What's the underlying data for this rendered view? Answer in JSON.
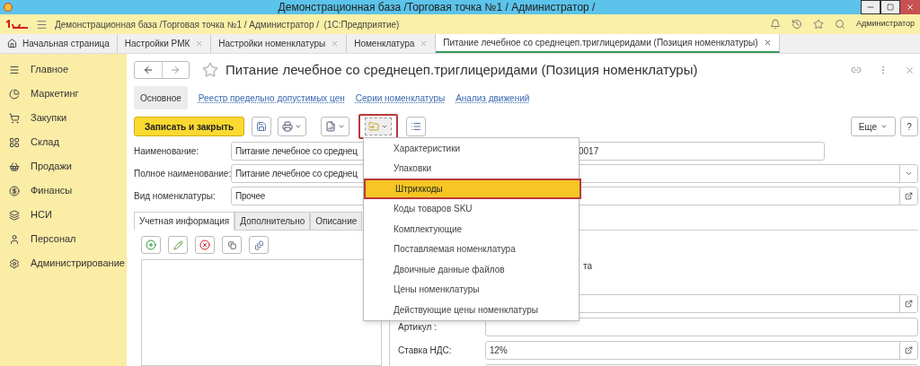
{
  "window": {
    "title": "Демонстрационная база /Торговая точка №1 / Администратор /"
  },
  "header": {
    "breadcrumb": "Демонстрационная база /Торговая точка №1 / Администратор /  (1С:Предприятие)",
    "user": "Администратор"
  },
  "open_tabs": [
    {
      "kind": "home",
      "label": "Начальная страница",
      "selected": false
    },
    {
      "kind": "page",
      "label": "Настройки РМК",
      "selected": false
    },
    {
      "kind": "page",
      "label": "Настройки номенклатуры",
      "selected": false
    },
    {
      "kind": "page",
      "label": "Номенклатура",
      "selected": false
    },
    {
      "kind": "page",
      "label": "Питание лечебное со среднецеп.триглицеридами (Позиция номенклатуры)",
      "selected": true
    }
  ],
  "sidebar": {
    "items": [
      {
        "label": "Главное"
      },
      {
        "label": "Маркетинг"
      },
      {
        "label": "Закупки"
      },
      {
        "label": "Склад"
      },
      {
        "label": "Продажи"
      },
      {
        "label": "Финансы"
      },
      {
        "label": "НСИ"
      },
      {
        "label": "Персонал"
      },
      {
        "label": "Администрирование"
      }
    ]
  },
  "form": {
    "title": "Питание лечебное со среднецеп.триглицеридами (Позиция номенклатуры)",
    "sections": [
      {
        "label": "Основное",
        "selected": true
      },
      {
        "label": "Реестр предельно допустимых цен",
        "selected": false
      },
      {
        "label": "Серии номенклатуры",
        "selected": false
      },
      {
        "label": "Анализ движений",
        "selected": false
      }
    ],
    "save_button": "Записать и закрыть",
    "create_menu": {
      "expanded": true
    },
    "more_button": "Еще",
    "help_button": "?",
    "fields": [
      {
        "kind": "text",
        "label": "Наименование:",
        "value": "Питание лечебное со среднец",
        "tail": "0017"
      },
      {
        "kind": "select",
        "label": "Полное наименование:",
        "value": "Питание лечебное со среднец"
      },
      {
        "kind": "open",
        "label": "Вид номенклатуры:",
        "value": "Прочее"
      }
    ],
    "tabs": [
      {
        "label": "Учетная информация",
        "selected": true
      },
      {
        "label": "Дополнительно",
        "selected": false
      },
      {
        "label": "Описание",
        "selected": false
      }
    ],
    "right_panel": {
      "fragment": "та",
      "fields": [
        {
          "kind": "open"
        },
        {
          "kind": "text",
          "label": "Артикул :"
        },
        {
          "kind": "open",
          "label": "Ставка НДС:",
          "value": "12%"
        },
        {
          "kind": "text"
        }
      ]
    }
  },
  "menu": {
    "items": [
      {
        "label": "Характеристики",
        "selected": false
      },
      {
        "label": "Упаковки",
        "selected": false
      },
      {
        "label": "Штрихкоды",
        "selected": true
      },
      {
        "label": "Коды товаров SKU",
        "selected": false
      },
      {
        "label": "Комплектующие",
        "selected": false
      },
      {
        "label": "Поставляемая номенклатура",
        "selected": false
      },
      {
        "label": "Двоичные данные файлов",
        "selected": false
      },
      {
        "label": "Цены номенклатуры",
        "selected": false
      },
      {
        "label": "Действующие цены номенклатуры",
        "selected": false
      }
    ]
  }
}
